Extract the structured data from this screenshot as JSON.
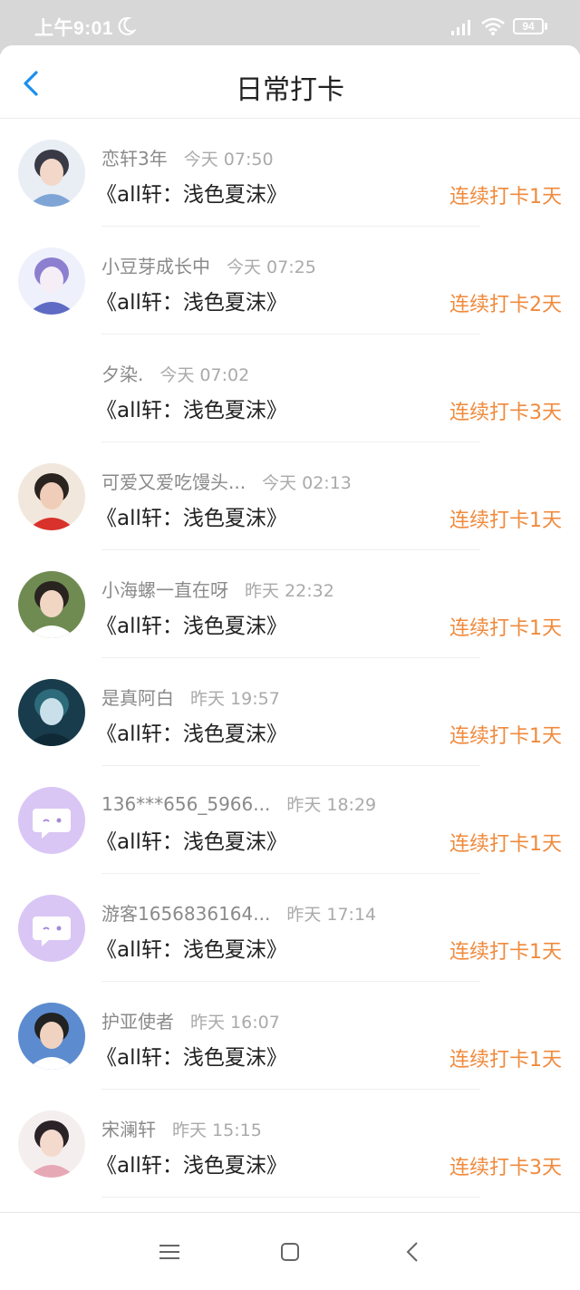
{
  "status": {
    "time": "上午9:01",
    "battery": "94"
  },
  "header": {
    "title": "日常打卡"
  },
  "records": [
    {
      "name": "恋轩3年",
      "time": "今天 07:50",
      "book": "《all轩：浅色夏沫》",
      "streak": "连续打卡1天",
      "avatar": "photo"
    },
    {
      "name": "小豆芽成长中",
      "time": "今天 07:25",
      "book": "《all轩：浅色夏沫》",
      "streak": "连续打卡2天",
      "avatar": "anime"
    },
    {
      "name": "夕染.",
      "time": "今天 07:02",
      "book": "《all轩：浅色夏沫》",
      "streak": "连续打卡3天",
      "avatar": "none"
    },
    {
      "name": "可爱又爱吃馒头...",
      "time": "今天 02:13",
      "book": "《all轩：浅色夏沫》",
      "streak": "连续打卡1天",
      "avatar": "photo-red"
    },
    {
      "name": "小海螺一直在呀",
      "time": "昨天 22:32",
      "book": "《all轩：浅色夏沫》",
      "streak": "连续打卡1天",
      "avatar": "photo-green"
    },
    {
      "name": "是真阿白",
      "time": "昨天 19:57",
      "book": "《all轩：浅色夏沫》",
      "streak": "连续打卡1天",
      "avatar": "text-dark"
    },
    {
      "name": "136***656_5966...",
      "time": "昨天 18:29",
      "book": "《all轩：浅色夏沫》",
      "streak": "连续打卡1天",
      "avatar": "default"
    },
    {
      "name": "游客1656836164...",
      "time": "昨天 17:14",
      "book": "《all轩：浅色夏沫》",
      "streak": "连续打卡1天",
      "avatar": "default"
    },
    {
      "name": "护亚使者",
      "time": "昨天 16:07",
      "book": "《all轩：浅色夏沫》",
      "streak": "连续打卡1天",
      "avatar": "photo-blue"
    },
    {
      "name": "宋澜轩",
      "time": "昨天 15:15",
      "book": "《all轩：浅色夏沫》",
      "streak": "连续打卡3天",
      "avatar": "photo-pink"
    }
  ],
  "colors": {
    "accent": "#f08a3c",
    "back": "#1a8ff0",
    "default_avatar": "#d9c6f5"
  }
}
